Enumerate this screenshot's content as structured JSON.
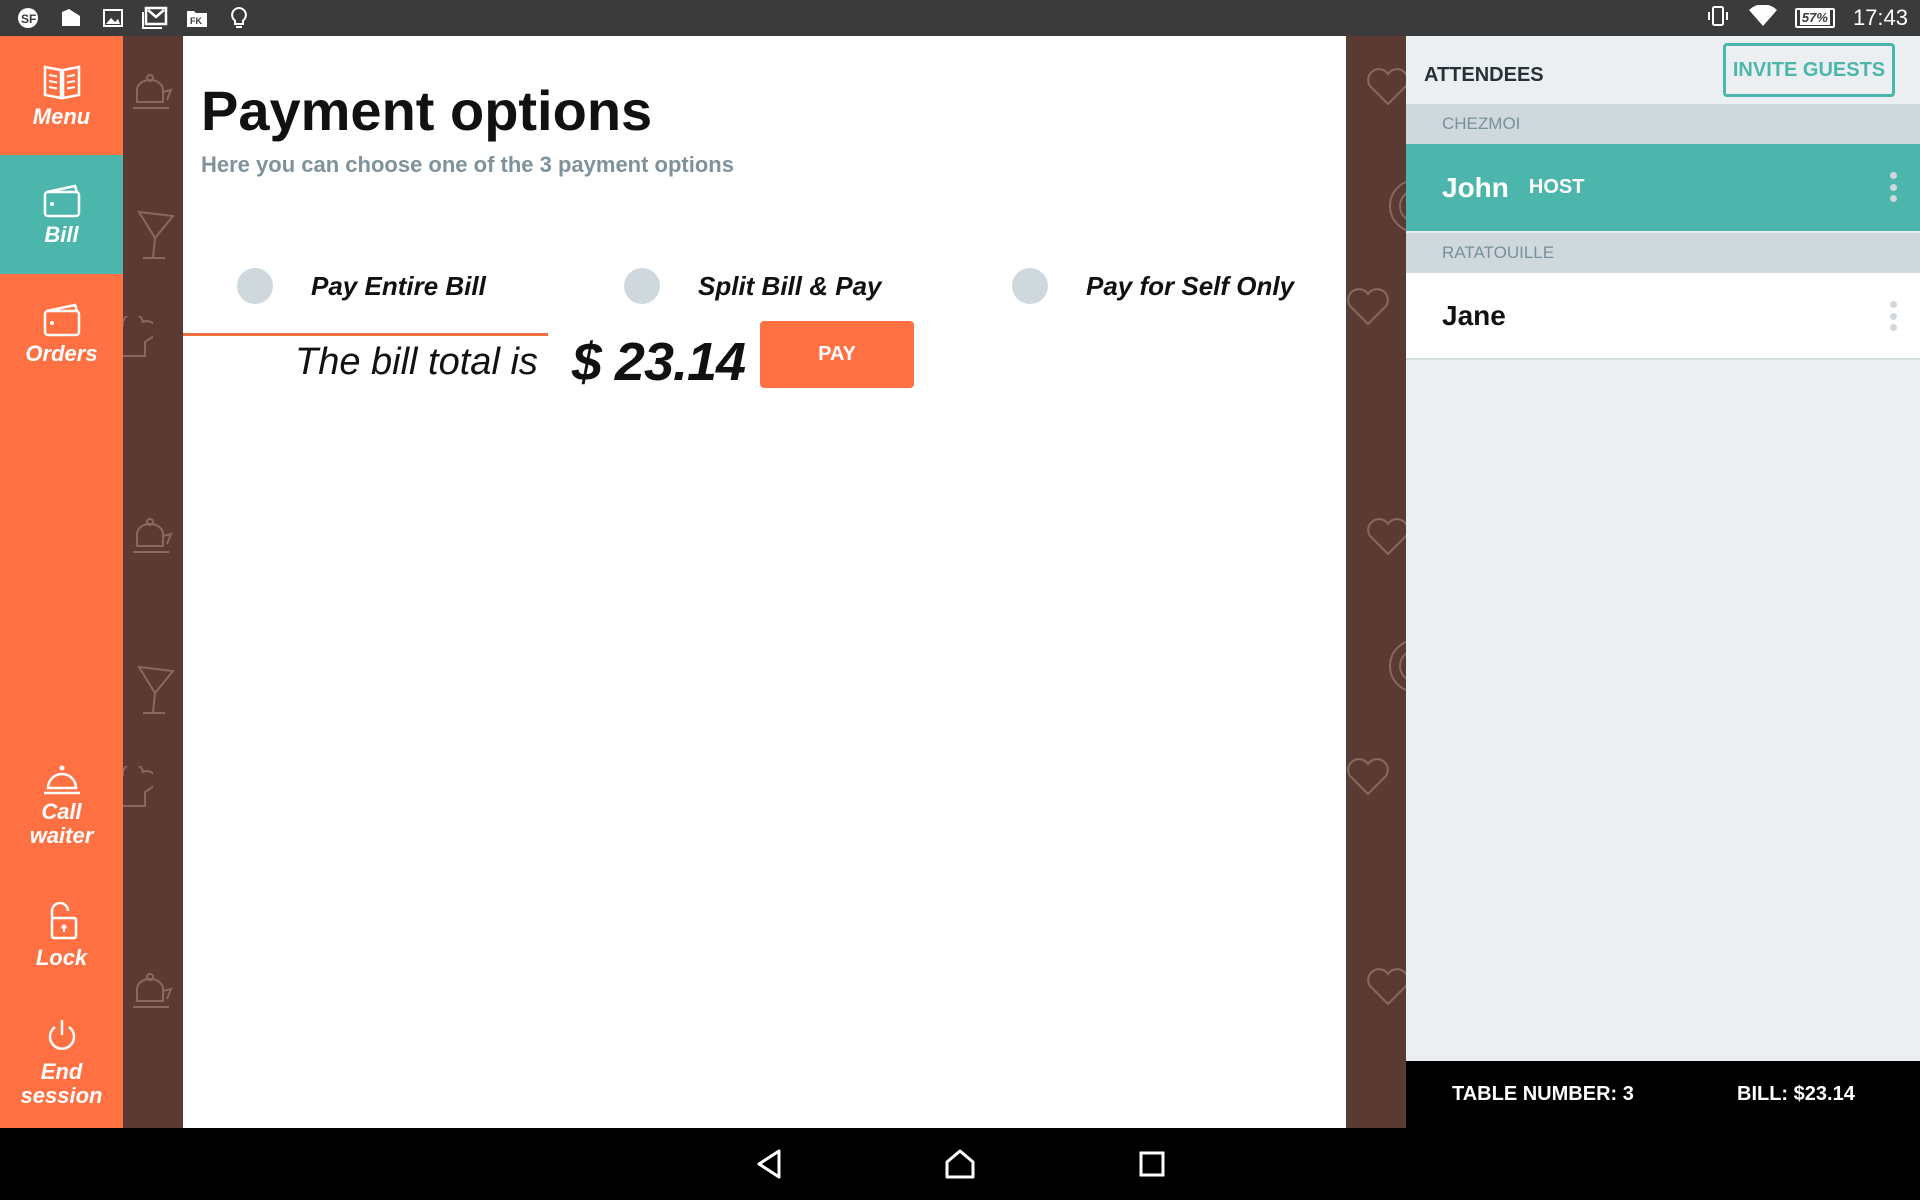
{
  "status_bar": {
    "left_icons": [
      "sf-app-icon",
      "color-swatch-icon",
      "image-icon",
      "gmail-icon",
      "fk-folder-icon",
      "lightbulb-icon"
    ],
    "battery": "57%",
    "time": "17:43"
  },
  "sidebar": {
    "items": [
      {
        "label": "Menu",
        "icon": "menu-book-icon",
        "active": false
      },
      {
        "label": "Bill",
        "icon": "wallet-icon",
        "active": true
      },
      {
        "label": "Orders",
        "icon": "wallet-icon",
        "active": false
      },
      {
        "label": "Call waiter",
        "icon": "service-bell-icon",
        "active": false
      },
      {
        "label": "Lock",
        "icon": "unlock-icon",
        "active": false
      },
      {
        "label": "End session",
        "icon": "power-icon",
        "active": false
      }
    ]
  },
  "main": {
    "title": "Payment options",
    "subtitle": "Here you can choose one of the 3 payment options",
    "tabs": [
      {
        "label": "Pay Entire Bill",
        "active": true
      },
      {
        "label": "Split Bill & Pay",
        "active": false
      },
      {
        "label": "Pay for Self Only",
        "active": false
      }
    ],
    "bill_text": "The bill total is",
    "bill_amount": "$ 23.14",
    "pay_label": "PAY"
  },
  "attendees": {
    "title": "ATTENDEES",
    "invite_label": "INVITE GUESTS",
    "groups": [
      {
        "name": "CHEZMOI",
        "members": [
          {
            "name": "John",
            "badge": "HOST"
          }
        ]
      },
      {
        "name": "RATATOUILLE",
        "members": [
          {
            "name": "Jane",
            "badge": ""
          }
        ]
      }
    ]
  },
  "footer": {
    "table": "TABLE NUMBER: 3",
    "bill": "BILL: $23.14"
  },
  "colors": {
    "accent_orange": "#ff7043",
    "accent_teal": "#4db6ac",
    "brown": "#5a3a32"
  }
}
